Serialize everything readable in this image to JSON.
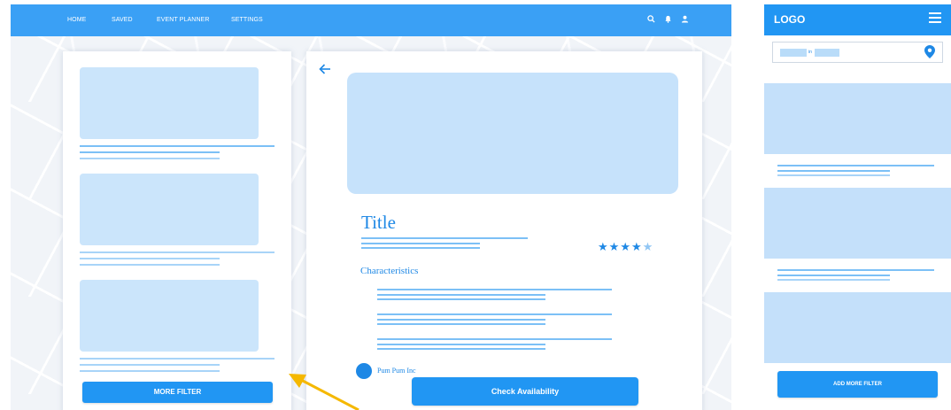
{
  "nav": {
    "links": [
      "HOME",
      "SAVED",
      "EVENT PLANNER",
      "SETTINGS"
    ],
    "icons": [
      "search-icon",
      "bell-icon",
      "user-icon"
    ],
    "color": "#3aa0f5"
  },
  "list": {
    "more_filter_label": "MORE FILTER"
  },
  "detail": {
    "back_icon": "arrow-left-icon",
    "title": "Title",
    "rating": 4,
    "rating_max": 5,
    "characteristics_label": "Characteristics",
    "owner_label": "Pum Pum Inc",
    "check_availability_label": "Check Availability"
  },
  "mobile": {
    "logo": "LOGO",
    "menu_icon": "hamburger-icon",
    "search_connector": "in",
    "location_icon": "map-pin-icon",
    "add_filter_label": "ADD MORE FILTER",
    "accent": "#2196f3"
  },
  "annotation": {
    "arrow_color": "#f5b800"
  }
}
